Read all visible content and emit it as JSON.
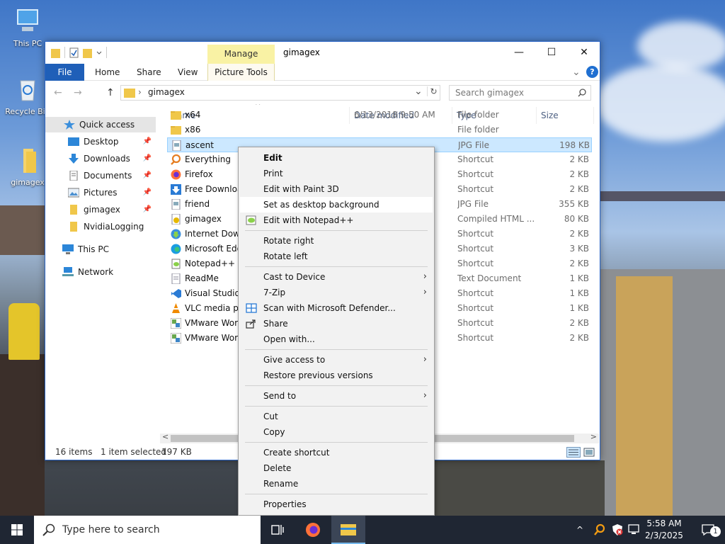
{
  "desktop": {
    "icons": [
      {
        "label": "This PC",
        "icon": "this-pc-icon"
      },
      {
        "label": "Recycle Bin",
        "icon": "recycle-bin-icon"
      },
      {
        "label": "gimagex",
        "icon": "folder-icon"
      }
    ]
  },
  "window": {
    "title": "gimagex",
    "manage_tab": "Manage",
    "controls": {
      "minimize": "—",
      "maximize": "☐",
      "close": "✕"
    },
    "ribbon": {
      "file": "File",
      "tabs": [
        "Home",
        "Share",
        "View"
      ],
      "picture_tools": "Picture Tools",
      "collapse": "⌄",
      "help": "?"
    },
    "address": {
      "back": "←",
      "forward": "→",
      "up": "↑",
      "separator": "›",
      "path": "gimagex",
      "dropdown": "⌄",
      "refresh": "↻",
      "search_placeholder": "Search gimagex"
    },
    "nav": {
      "quick_access": "Quick access",
      "items": [
        {
          "label": "Desktop",
          "pin": "📌"
        },
        {
          "label": "Downloads",
          "pin": "📌"
        },
        {
          "label": "Documents",
          "pin": "📌"
        },
        {
          "label": "Pictures",
          "pin": "📌"
        },
        {
          "label": "gimagex",
          "pin": "📌"
        },
        {
          "label": "NvidiaLogging",
          "pin": ""
        }
      ],
      "this_pc": "This PC",
      "network": "Network"
    },
    "columns": {
      "name": "Name",
      "date": "Date modified",
      "type": "Type",
      "size": "Size",
      "sort_indicator": "^"
    },
    "files": [
      {
        "name": "x64",
        "date": "6/13/2018 9:50 AM",
        "type": "File folder",
        "size": "",
        "icon": "folder-icon"
      },
      {
        "name": "x86",
        "date": "",
        "type": "File folder",
        "size": "",
        "icon": "folder-icon"
      },
      {
        "name": "ascent",
        "date": "",
        "type": "JPG File",
        "size": "198 KB",
        "icon": "image-file-icon"
      },
      {
        "name": "Everything",
        "date": "",
        "type": "Shortcut",
        "size": "2 KB",
        "icon": "everything-icon"
      },
      {
        "name": "Firefox",
        "date": "",
        "type": "Shortcut",
        "size": "2 KB",
        "icon": "firefox-icon"
      },
      {
        "name": "Free Download",
        "date": "",
        "type": "Shortcut",
        "size": "2 KB",
        "icon": "download-app-icon"
      },
      {
        "name": "friend",
        "date": "",
        "type": "JPG File",
        "size": "355 KB",
        "icon": "image-file-icon"
      },
      {
        "name": "gimagex",
        "date": "",
        "type": "Compiled HTML ...",
        "size": "80 KB",
        "icon": "chm-file-icon"
      },
      {
        "name": "Internet Down",
        "date": "",
        "type": "Shortcut",
        "size": "2 KB",
        "icon": "idm-icon"
      },
      {
        "name": "Microsoft Edg",
        "date": "",
        "type": "Shortcut",
        "size": "3 KB",
        "icon": "edge-icon"
      },
      {
        "name": "Notepad++",
        "date": "",
        "type": "Shortcut",
        "size": "2 KB",
        "icon": "notepadpp-icon"
      },
      {
        "name": "ReadMe",
        "date": "",
        "type": "Text Document",
        "size": "1 KB",
        "icon": "text-file-icon"
      },
      {
        "name": "Visual Studio C",
        "date": "",
        "type": "Shortcut",
        "size": "1 KB",
        "icon": "vscode-icon"
      },
      {
        "name": "VLC media pla",
        "date": "",
        "type": "Shortcut",
        "size": "1 KB",
        "icon": "vlc-icon"
      },
      {
        "name": "VMware Work",
        "date": "",
        "type": "Shortcut",
        "size": "2 KB",
        "icon": "vmware-icon"
      },
      {
        "name": "VMware Work",
        "date": "",
        "type": "Shortcut",
        "size": "2 KB",
        "icon": "vmware-icon"
      }
    ],
    "hscroll": {
      "left": "<",
      "right": ">"
    },
    "status": {
      "items": "16 items",
      "selected": "1 item selected",
      "size": "197 KB"
    }
  },
  "context_menu": {
    "groups": [
      [
        {
          "label": "Edit",
          "bold": true
        },
        {
          "label": "Print"
        },
        {
          "label": "Edit with Paint 3D"
        },
        {
          "label": "Set as desktop background",
          "highlight": true
        },
        {
          "label": "Edit with Notepad++",
          "icon": "notepadpp-icon"
        }
      ],
      [
        {
          "label": "Rotate right"
        },
        {
          "label": "Rotate left"
        }
      ],
      [
        {
          "label": "Cast to Device",
          "submenu": true
        },
        {
          "label": "7-Zip",
          "submenu": true
        },
        {
          "label": "Scan with Microsoft Defender...",
          "icon": "defender-icon"
        },
        {
          "label": "Share",
          "icon": "share-icon"
        },
        {
          "label": "Open with..."
        }
      ],
      [
        {
          "label": "Give access to",
          "submenu": true
        },
        {
          "label": "Restore previous versions"
        }
      ],
      [
        {
          "label": "Send to",
          "submenu": true
        }
      ],
      [
        {
          "label": "Cut"
        },
        {
          "label": "Copy"
        }
      ],
      [
        {
          "label": "Create shortcut"
        },
        {
          "label": "Delete"
        },
        {
          "label": "Rename"
        }
      ],
      [
        {
          "label": "Properties"
        }
      ]
    ],
    "submenu_arrow": "›"
  },
  "taskbar": {
    "search_placeholder": "Type here to search",
    "clock_time": "5:58 AM",
    "clock_date": "2/3/2025",
    "notification_count": "1",
    "tray_chevron": "^"
  },
  "colors": {
    "accent": "#1f5fb8",
    "selection": "#cce8ff",
    "manage": "#f9f2a4",
    "taskbar": "#1f2633"
  }
}
